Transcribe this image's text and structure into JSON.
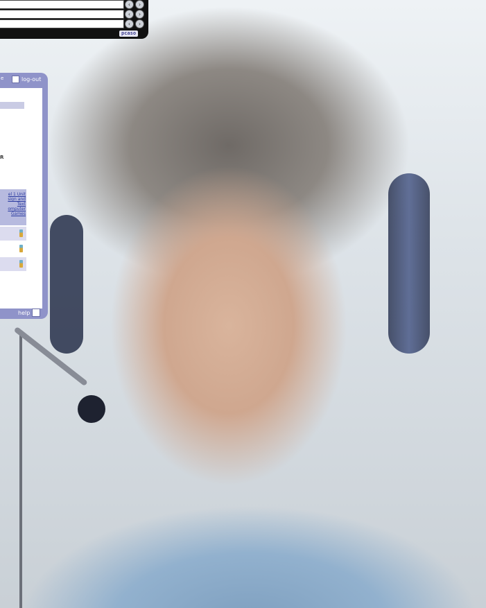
{
  "toolbar": {
    "logo_text": "pcaso"
  },
  "panel": {
    "logout_label": "log-out",
    "partial_tab_text": "e",
    "fragment_letter": "R",
    "table_header_text": "el 1 Unit sign and Text omputer Games",
    "help_label": "help"
  },
  "icons": {
    "nav_buttons": "circle-arrow-icons",
    "logout": "logout-icon",
    "help": "help-icon",
    "table_cell": "bottle-icon"
  },
  "colors": {
    "panel": "#8f93c9",
    "toolbar": "#111111",
    "link": "#2a3a9f",
    "headset": "#2d3754"
  }
}
